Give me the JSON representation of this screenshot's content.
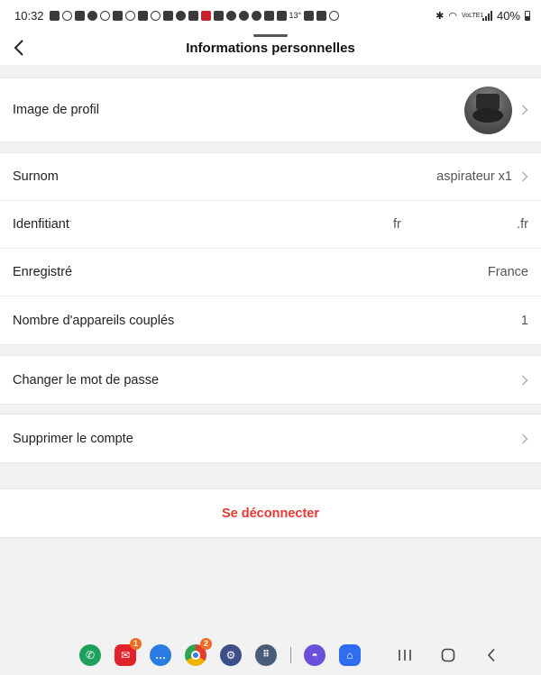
{
  "status_bar": {
    "time": "10:32",
    "temperature": "13°",
    "network": "VoLTE1",
    "battery": "40%"
  },
  "header": {
    "title": "Informations personnelles",
    "back_icon": "chevron-left-icon"
  },
  "profile": {
    "label": "Image de profil"
  },
  "account": {
    "nickname_label": "Surnom",
    "nickname_value": "aspirateur x1",
    "identifier_label": "Idenfitiant",
    "identifier_value_start": "fr",
    "identifier_value_end": ".fr",
    "registered_label": "Enregistré",
    "registered_value": "France",
    "paired_label": "Nombre d'appareils couplés",
    "paired_value": "1"
  },
  "actions": {
    "change_password": "Changer le mot de passe",
    "delete_account": "Supprimer le compte",
    "logout": "Se déconnecter"
  },
  "dock": {
    "apps": [
      {
        "name": "phone",
        "color": "#1fa05a",
        "badge": ""
      },
      {
        "name": "email",
        "color": "#e0222b",
        "badge": "1"
      },
      {
        "name": "messages",
        "color": "#2b7be4",
        "badge": ""
      },
      {
        "name": "chrome",
        "color": "#f0b400",
        "badge": "2"
      },
      {
        "name": "settings",
        "color": "#3c4f87",
        "badge": ""
      },
      {
        "name": "apps-grid",
        "color": "#4a5d78",
        "badge": ""
      },
      {
        "name": "internet",
        "color": "#6a4fd8",
        "badge": ""
      },
      {
        "name": "smartthings",
        "color": "#2f6df0",
        "badge": ""
      }
    ]
  },
  "colors": {
    "accent_red": "#e53935",
    "background": "#f2f2f2"
  }
}
